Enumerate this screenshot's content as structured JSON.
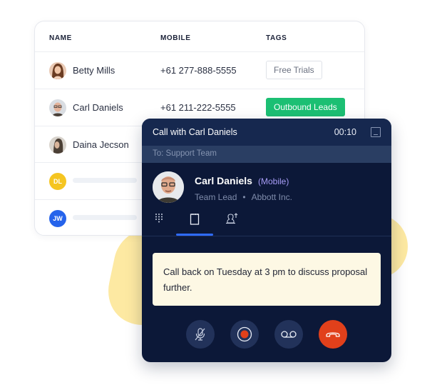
{
  "table": {
    "headers": [
      "NAME",
      "MOBILE",
      "TAGS"
    ],
    "rows": [
      {
        "name": "Betty Mills",
        "mobile": "+61 277-888-5555",
        "tag": "Free Trials",
        "tag_style": "outline"
      },
      {
        "name": "Carl Daniels",
        "mobile": "+61 211-222-5555",
        "tag": "Outbound Leads",
        "tag_style": "green"
      },
      {
        "name": "Daina Jecson",
        "mobile": "",
        "tag": ""
      },
      {
        "initials": "DL",
        "avatar_color": "#f5c521"
      },
      {
        "initials": "JW",
        "avatar_color": "#2563eb"
      }
    ]
  },
  "call": {
    "title": "Call with Carl Daniels",
    "timer": "00:10",
    "to": "To: Support Team",
    "contact": {
      "name": "Carl Daniels",
      "phone_type": "(Mobile)",
      "role": "Team Lead",
      "separator": "•",
      "company": "Abbott Inc."
    },
    "tabs": [
      {
        "icon": "dialpad-icon",
        "active": false
      },
      {
        "icon": "notes-icon",
        "active": true
      },
      {
        "icon": "transfer-icon",
        "active": false
      }
    ],
    "note": "Call back on Tuesday at 3 pm to discuss proposal further.",
    "controls": [
      "mute",
      "record",
      "voicemail",
      "end-call"
    ]
  },
  "colors": {
    "accent_blue": "#2f6bff",
    "tag_green": "#1cbf73",
    "end_call": "#e1401b",
    "widget_bg": "#0c1838",
    "mobile_label": "#a79cf6"
  }
}
